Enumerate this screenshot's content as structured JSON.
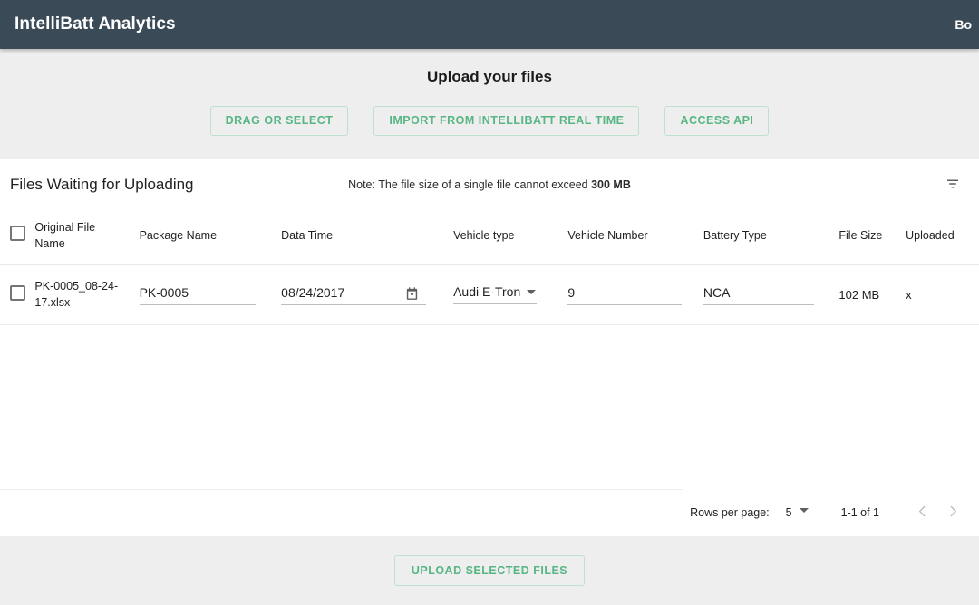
{
  "appbar": {
    "title": "IntelliBatt Analytics",
    "user": "Bo"
  },
  "upload": {
    "title": "Upload your files",
    "buttons": [
      {
        "label": "DRAG OR SELECT",
        "name": "drag-or-select-button"
      },
      {
        "label": "IMPORT FROM INTELLIBATT REAL TIME",
        "name": "import-realtime-button"
      },
      {
        "label": "ACCESS API",
        "name": "access-api-button"
      }
    ]
  },
  "card": {
    "title": "Files Waiting for Uploading",
    "note_prefix": "Note: The file size of a single file cannot exceed ",
    "note_limit": "300 MB",
    "filter_icon": "filter-list-icon"
  },
  "table": {
    "columns": [
      {
        "key": "select",
        "label": ""
      },
      {
        "key": "original_name",
        "label": "Original File Name"
      },
      {
        "key": "package_name",
        "label": "Package Name"
      },
      {
        "key": "data_time",
        "label": "Data Time"
      },
      {
        "key": "vehicle_type",
        "label": "Vehicle type"
      },
      {
        "key": "vehicle_number",
        "label": "Vehicle Number"
      },
      {
        "key": "battery_type",
        "label": "Battery Type"
      },
      {
        "key": "file_size",
        "label": "File Size"
      },
      {
        "key": "uploaded",
        "label": "Uploaded"
      }
    ],
    "rows": [
      {
        "selected": false,
        "original_name": "PK-0005_08-24-17.xlsx",
        "package_name": "PK-0005",
        "data_time": "08/24/2017",
        "calendar_icon": "calendar-icon",
        "vehicle_type": "Audi E-Tron",
        "vehicle_number": "9",
        "battery_type": "NCA",
        "file_size": "102 MB",
        "uploaded": "x"
      }
    ]
  },
  "pagination": {
    "rows_per_page_label": "Rows per page:",
    "rows_per_page_value": "5",
    "range": "1-1 of 1",
    "prev_icon": "chevron-left-icon",
    "next_icon": "chevron-right-icon"
  },
  "footer": {
    "upload_button": "UPLOAD SELECTED FILES"
  },
  "colors": {
    "appbar_bg": "#3a4a57",
    "accent_green": "#57b684",
    "accent_green_border": "#bfe0cd",
    "page_bg": "#eeeeee",
    "card_bg": "#ffffff"
  }
}
